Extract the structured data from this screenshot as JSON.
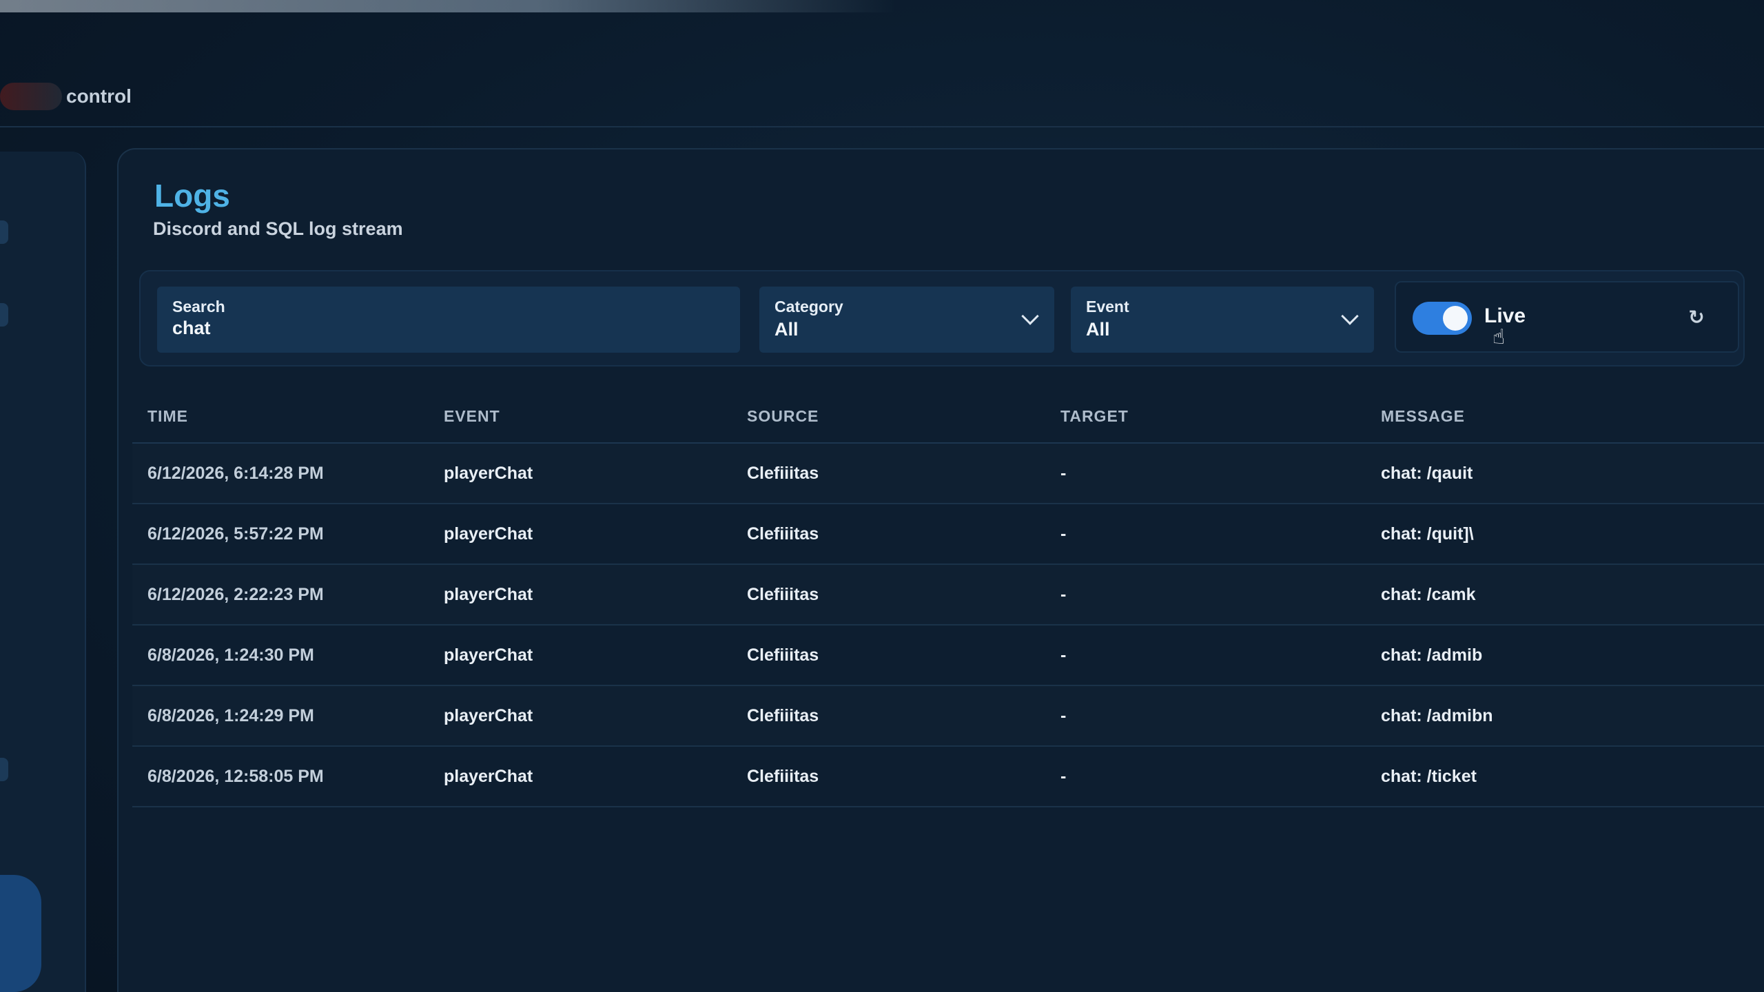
{
  "app": {
    "brand_label": "control"
  },
  "page": {
    "title": "Logs",
    "subtitle": "Discord and SQL log stream"
  },
  "filters": {
    "search": {
      "label": "Search",
      "value": "chat"
    },
    "category": {
      "label": "Category",
      "value": "All"
    },
    "event": {
      "label": "Event",
      "value": "All"
    },
    "live": {
      "label": "Live",
      "enabled": true
    },
    "refresh_icon": "refresh-icon"
  },
  "table": {
    "columns": [
      "TIME",
      "EVENT",
      "SOURCE",
      "TARGET",
      "MESSAGE"
    ],
    "rows": [
      [
        "6/12/2026, 6:14:28 PM",
        "playerChat",
        "Clefiiitas",
        "-",
        "chat: /qauit"
      ],
      [
        "6/12/2026, 5:57:22 PM",
        "playerChat",
        "Clefiiitas",
        "-",
        "chat: /quit]\\"
      ],
      [
        "6/12/2026, 2:22:23 PM",
        "playerChat",
        "Clefiiitas",
        "-",
        "chat: /camk"
      ],
      [
        "6/8/2026, 1:24:30 PM",
        "playerChat",
        "Clefiiitas",
        "-",
        "chat: /admib"
      ],
      [
        "6/8/2026, 1:24:29 PM",
        "playerChat",
        "Clefiiitas",
        "-",
        "chat: /admibn"
      ],
      [
        "6/8/2026, 12:58:05 PM",
        "playerChat",
        "Clefiiitas",
        "-",
        "chat: /ticket"
      ]
    ]
  },
  "colors": {
    "accent": "#4fb3e6",
    "toggle_on": "#2e7fe0",
    "background": "#0b1a2a"
  }
}
